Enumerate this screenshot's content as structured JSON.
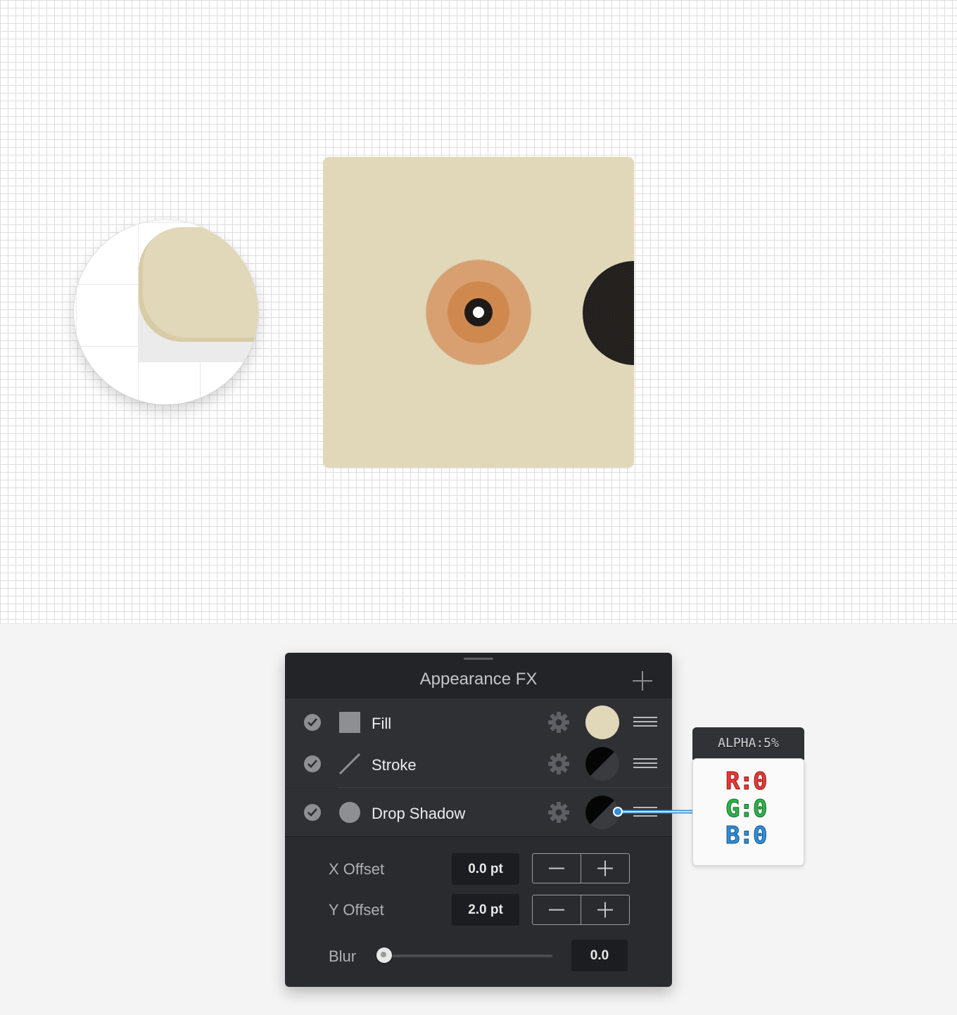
{
  "panel": {
    "title": "Appearance FX",
    "layers": [
      {
        "label": "Fill",
        "swatch_color": "#e1d7b9",
        "enabled": true
      },
      {
        "label": "Stroke",
        "swatch_color": "black-half",
        "enabled": true
      },
      {
        "label": "Drop Shadow",
        "swatch_color": "black-half",
        "enabled": true
      }
    ],
    "x_offset": {
      "label": "X Offset",
      "value": "0.0 pt"
    },
    "y_offset": {
      "label": "Y Offset",
      "value": "2.0 pt"
    },
    "blur": {
      "label": "Blur",
      "value": "0.0",
      "level": 0
    }
  },
  "callout": {
    "alpha": "ALPHA:5%",
    "r": "R:0",
    "g": "G:0",
    "b": "B:0"
  },
  "colors": {
    "sleeve": "#e1d7b9",
    "label_outer": "#d8a070",
    "label_inner": "#cf894e",
    "vinyl": "#252220",
    "panel_bg": "#2a2b2e",
    "r_color": "#e53935",
    "g_color": "#2eb34a",
    "b_color": "#2f8fd8"
  },
  "icons": [
    "check-icon",
    "fill-square-icon",
    "stroke-line-icon",
    "drop-shadow-circle-icon",
    "gear-icon",
    "menu-icon",
    "plus-icon",
    "minus-icon"
  ]
}
